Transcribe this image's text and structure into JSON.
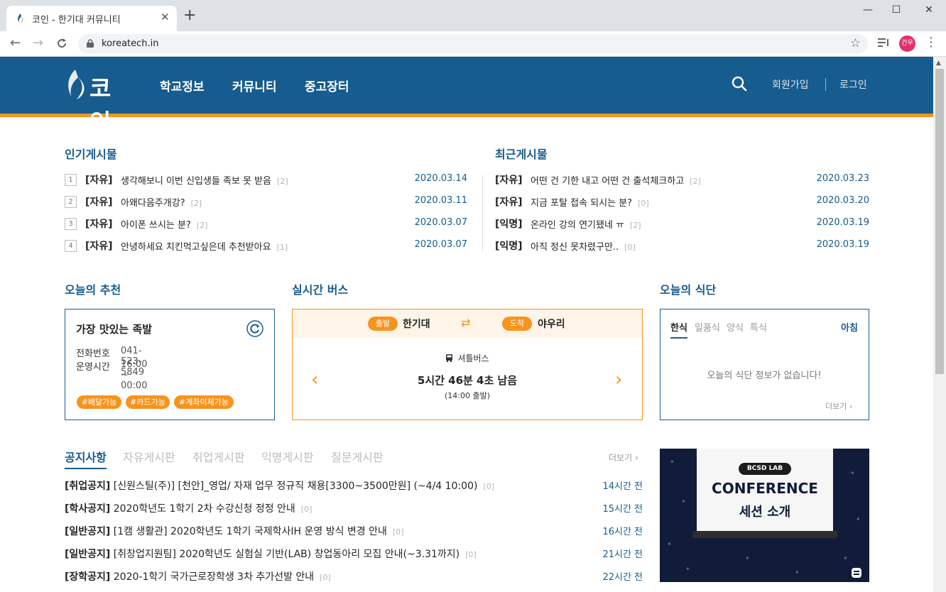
{
  "browser": {
    "tab_title": "코인 - 한기대 커뮤니티",
    "tab_close": "✕",
    "new_tab": "+",
    "minimize": "—",
    "maximize": "☐",
    "close": "✕",
    "url": "koreatech.in",
    "profile_initials": "건우"
  },
  "header": {
    "logo_text": "코인",
    "nav": [
      "학교정보",
      "커뮤니티",
      "중고장터"
    ],
    "signup": "회원가입",
    "login": "로그인"
  },
  "popular": {
    "title": "인기게시물",
    "posts": [
      {
        "rank": "1",
        "tag": "[자유]",
        "title": "생각해보니 이번 신입생들 족보 못 받음",
        "count": "[2]",
        "date": "2020.03.14"
      },
      {
        "rank": "2",
        "tag": "[자유]",
        "title": "아왜다음주개강?",
        "count": "[2]",
        "date": "2020.03.11"
      },
      {
        "rank": "3",
        "tag": "[자유]",
        "title": "아이폰 쓰시는 분?",
        "count": "[2]",
        "date": "2020.03.07"
      },
      {
        "rank": "4",
        "tag": "[자유]",
        "title": "안녕하세요 치킨먹고싶은데 추천받아요",
        "count": "[1]",
        "date": "2020.03.07"
      }
    ]
  },
  "recent": {
    "title": "최근게시물",
    "posts": [
      {
        "tag": "[자유]",
        "title": "어떤 건 기한 내고 어떤 건 출석체크하고",
        "count": "[2]",
        "date": "2020.03.23"
      },
      {
        "tag": "[자유]",
        "title": "지금 포탈 접속 되시는 분?",
        "count": "[0]",
        "date": "2020.03.20"
      },
      {
        "tag": "[익명]",
        "title": "온라인 강의 연기됐네 ㅠ",
        "count": "[2]",
        "date": "2020.03.19"
      },
      {
        "tag": "[익명]",
        "title": "아직 정신 못차렸구만..",
        "count": "[0]",
        "date": "2020.03.19"
      }
    ]
  },
  "recommend": {
    "title": "오늘의 추천",
    "name": "가장 맛있는 족발",
    "phone_label": "전화번호",
    "phone": "041-523-5849",
    "hours_label": "운영시간",
    "hours": "16:00 ~ 00:00",
    "chips": [
      "#배달가능",
      "#카드가능",
      "#계좌이체가능"
    ]
  },
  "bus": {
    "title": "실시간 버스",
    "depart_label": "출발",
    "depart": "한기대",
    "swap_icon": "⇄",
    "arrive_label": "도착",
    "arrive": "야우리",
    "type": "셔틀버스",
    "remaining": "5시간 46분 4초 남음",
    "departure_time": "(14:00 출발)",
    "prev": "‹",
    "next": "›"
  },
  "meal": {
    "title": "오늘의 식단",
    "tabs": [
      "한식",
      "일품식",
      "양식",
      "특식"
    ],
    "time": "아침",
    "empty": "오늘의 식단 정보가 없습니다!",
    "more": "더보기 ›"
  },
  "boards": {
    "tabs": [
      "공지사항",
      "자유게시판",
      "취업게시판",
      "익명게시판",
      "질문게시판"
    ],
    "more": "더보기 ›",
    "notices": [
      {
        "cat": "[취업공지]",
        "title": " [신원스틸(주)] [천안]_영업/ 자재 업무 정규직 채용[3300~3500만원] (~4/4 10:00)",
        "count": "[0]",
        "time": "14시간 전"
      },
      {
        "cat": "[학사공지]",
        "title": " 2020학년도 1학기 2차 수강신청 정정 안내",
        "count": "[0]",
        "time": "15시간 전"
      },
      {
        "cat": "[일반공지]",
        "title": " [1캠 생활관] 2020학년도 1학기 국제학사IH 운영 방식 변경 안내",
        "count": "[0]",
        "time": "16시간 전"
      },
      {
        "cat": "[일반공지]",
        "title": " [취창업지원팀] 2020학년도 실험실 기반(LAB) 창업동아리 모집 안내(~3.31까지)",
        "count": "[0]",
        "time": "21시간 전"
      },
      {
        "cat": "[장학공지]",
        "title": " 2020-1학기 국가근로장학생 3차 추가선발 안내",
        "count": "[0]",
        "time": "22시간 전"
      }
    ]
  },
  "banner": {
    "badge": "BCSD LAB",
    "line1": "CONFERENCE",
    "line2": "세션 소개"
  },
  "colors": {
    "brand_blue": "#175c8e",
    "accent_orange": "#f7941e"
  }
}
